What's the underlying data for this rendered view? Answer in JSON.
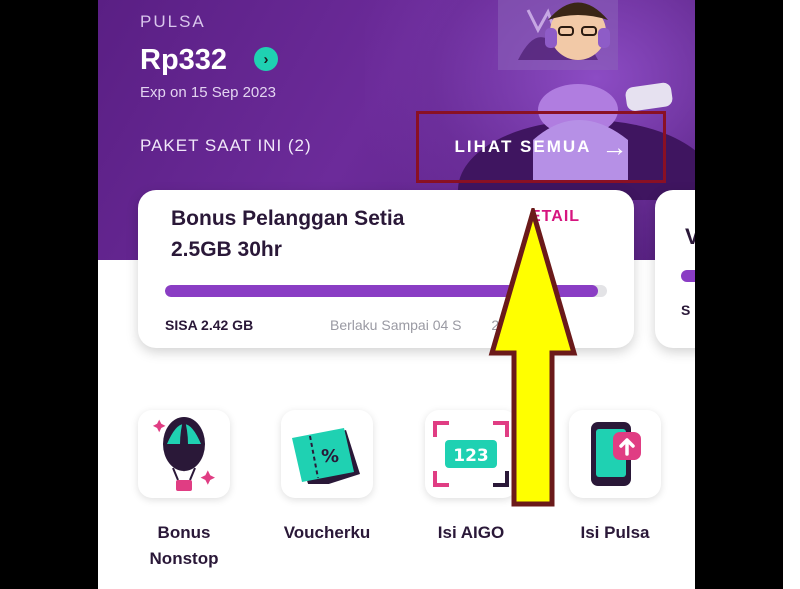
{
  "header": {
    "pulsa_label": "PULSA",
    "balance": "Rp332",
    "expiry": "Exp on 15 Sep 2023",
    "paket_label": "PAKET SAAT INI (2)",
    "see_all_label": "LIHAT SEMUA"
  },
  "package": {
    "name": "Bonus Pelanggan Setia",
    "quota": "2.5GB 30hr",
    "detail_label": "DETAIL",
    "detail_visible": "ETAIL",
    "remaining": "SISA 2.42 GB",
    "expiry": "Berlaku Sampai 04 S",
    "expiry_time": "22:10",
    "usage_remaining_percent": 98
  },
  "peek_card": {
    "first_letter": "V",
    "sisa_letter": "S"
  },
  "menu": [
    {
      "line1": "Bonus",
      "line2": "Nonstop",
      "icon": "balloon-icon"
    },
    {
      "line1": "Voucherku",
      "line2": "",
      "icon": "voucher-icon"
    },
    {
      "line1": "Isi AIGO",
      "line2": "",
      "icon": "aigo-icon"
    },
    {
      "line1": "Isi Pulsa",
      "line2": "",
      "icon": "phone-topup-icon"
    }
  ],
  "aigo_code": "123",
  "voucher_symbol": "%",
  "colors": {
    "hero_purple": "#6c2b9a",
    "accent_teal": "#1fd1b2",
    "accent_pink": "#d6157f",
    "progress_purple": "#8a3dc4",
    "highlight_box": "#8a1024",
    "pointer_arrow": "#ffff00"
  }
}
